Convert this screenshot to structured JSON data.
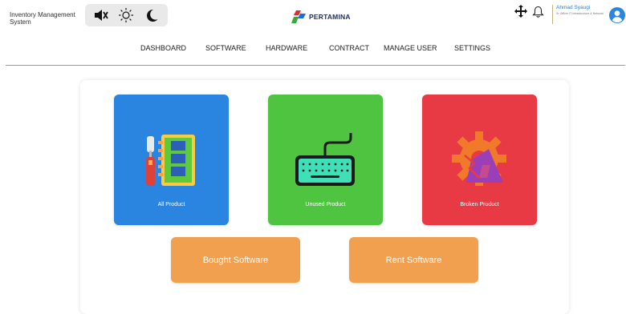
{
  "app": {
    "title": "Inventory Management System"
  },
  "brand": {
    "name": "PERTAMINA"
  },
  "toggles": {
    "icons": [
      "speaker-muted-icon",
      "sun-icon",
      "moon-icon"
    ]
  },
  "user": {
    "name": "Ahmad Syaugi",
    "role": "Sr Officer IT Infrastructure & Network"
  },
  "nav": [
    "DASHBOARD",
    "SOFTWARE",
    "HARDWARE",
    "CONTRACT",
    "MANAGE USER",
    "SETTINGS"
  ],
  "cards": [
    {
      "label": "All Product",
      "color": "#2a85e0",
      "icon": "hardware-tools-icon"
    },
    {
      "label": "Unused Product",
      "color": "#4fc441",
      "icon": "keyboard-icon"
    },
    {
      "label": "Broken Product",
      "color": "#e83a45",
      "icon": "broken-gear-icon"
    }
  ],
  "buttons": [
    {
      "label": "Bought Software",
      "color": "#f0a04e"
    },
    {
      "label": "Rent Software",
      "color": "#f0a04e"
    }
  ]
}
